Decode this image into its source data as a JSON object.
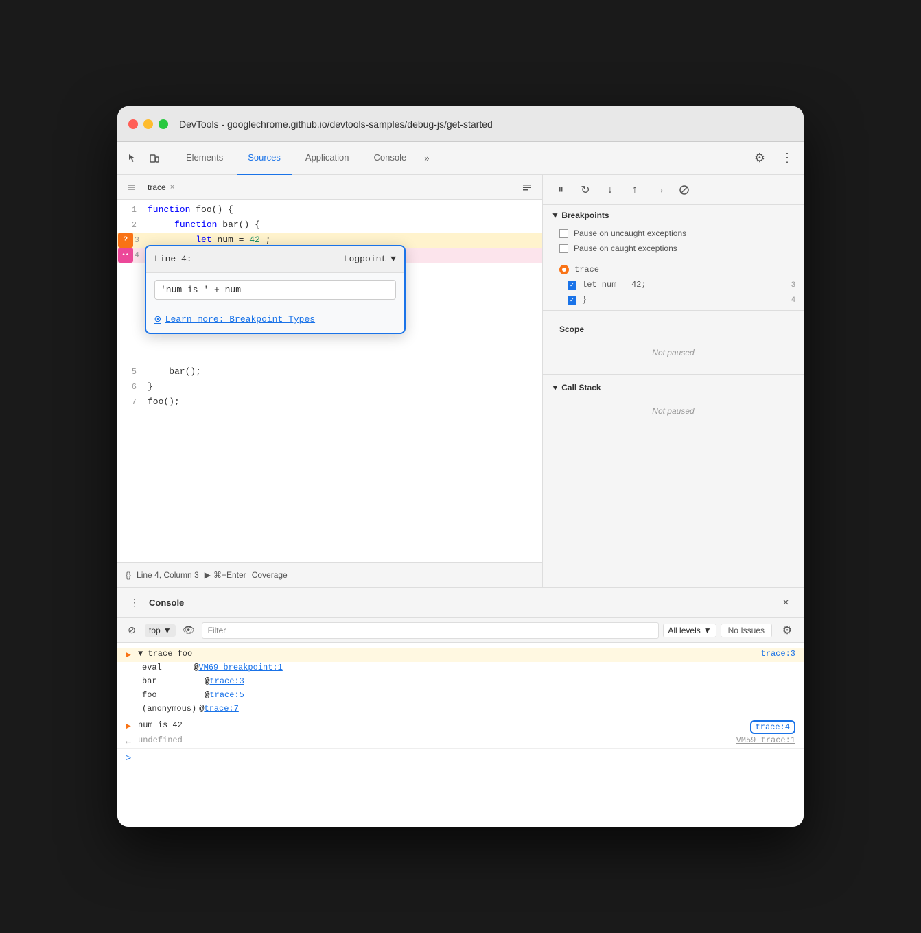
{
  "window": {
    "title": "DevTools - googlechrome.github.io/devtools-samples/debug-js/get-started"
  },
  "tabs": {
    "elements": "Elements",
    "sources": "Sources",
    "application": "Application",
    "console": "Console",
    "more": "»"
  },
  "file_tab": {
    "name": "trace",
    "close": "×"
  },
  "code": {
    "lines": [
      {
        "num": "1",
        "content": "function foo() {"
      },
      {
        "num": "2",
        "content": "    function bar() {"
      },
      {
        "num": "3",
        "content": "        let num = 42;"
      },
      {
        "num": "4",
        "content": "    }"
      },
      {
        "num": "5",
        "content": "    bar();"
      },
      {
        "num": "6",
        "content": "}"
      },
      {
        "num": "7",
        "content": "foo();"
      }
    ]
  },
  "logpoint": {
    "header_label": "Line 4:",
    "type": "Logpoint",
    "input_value": "'num is ' + num",
    "learn_more": "Learn more: Breakpoint Types"
  },
  "debugger": {
    "breakpoints_title": "▼ Breakpoints",
    "pause_uncaught": "Pause on uncaught exceptions",
    "pause_caught": "Pause on caught exceptions",
    "bp_trace": "trace",
    "bp_let": "let num = 42;",
    "bp_let_line": "3",
    "bp_brace": "}",
    "bp_brace_line": "4",
    "scope_title": "Scope",
    "scope_not_paused": "Not paused",
    "callstack_title": "▼ Call Stack",
    "callstack_not_paused": "Not paused"
  },
  "status_bar": {
    "location": "Line 4, Column 3",
    "run_label": "⌘+Enter",
    "coverage": "Coverage"
  },
  "console_section": {
    "title": "Console",
    "close": "×",
    "filter_placeholder": "Filter",
    "top_label": "top",
    "levels_label": "All levels",
    "no_issues_label": "No Issues"
  },
  "console_output": {
    "group_header": "▼ trace  foo",
    "group_link": "trace:3",
    "eval_label": "eval",
    "eval_link": "VM69 breakpoint:1",
    "bar_label": "bar",
    "bar_link": "trace:3",
    "foo_label": "foo",
    "foo_link": "trace:5",
    "anon_label": "(anonymous)",
    "anon_link": "trace:7",
    "result_text": "num is 42",
    "result_link": "trace:4",
    "undefined_text": "← undefined",
    "undefined_link": "VM59 trace:1",
    "prompt": ">"
  }
}
